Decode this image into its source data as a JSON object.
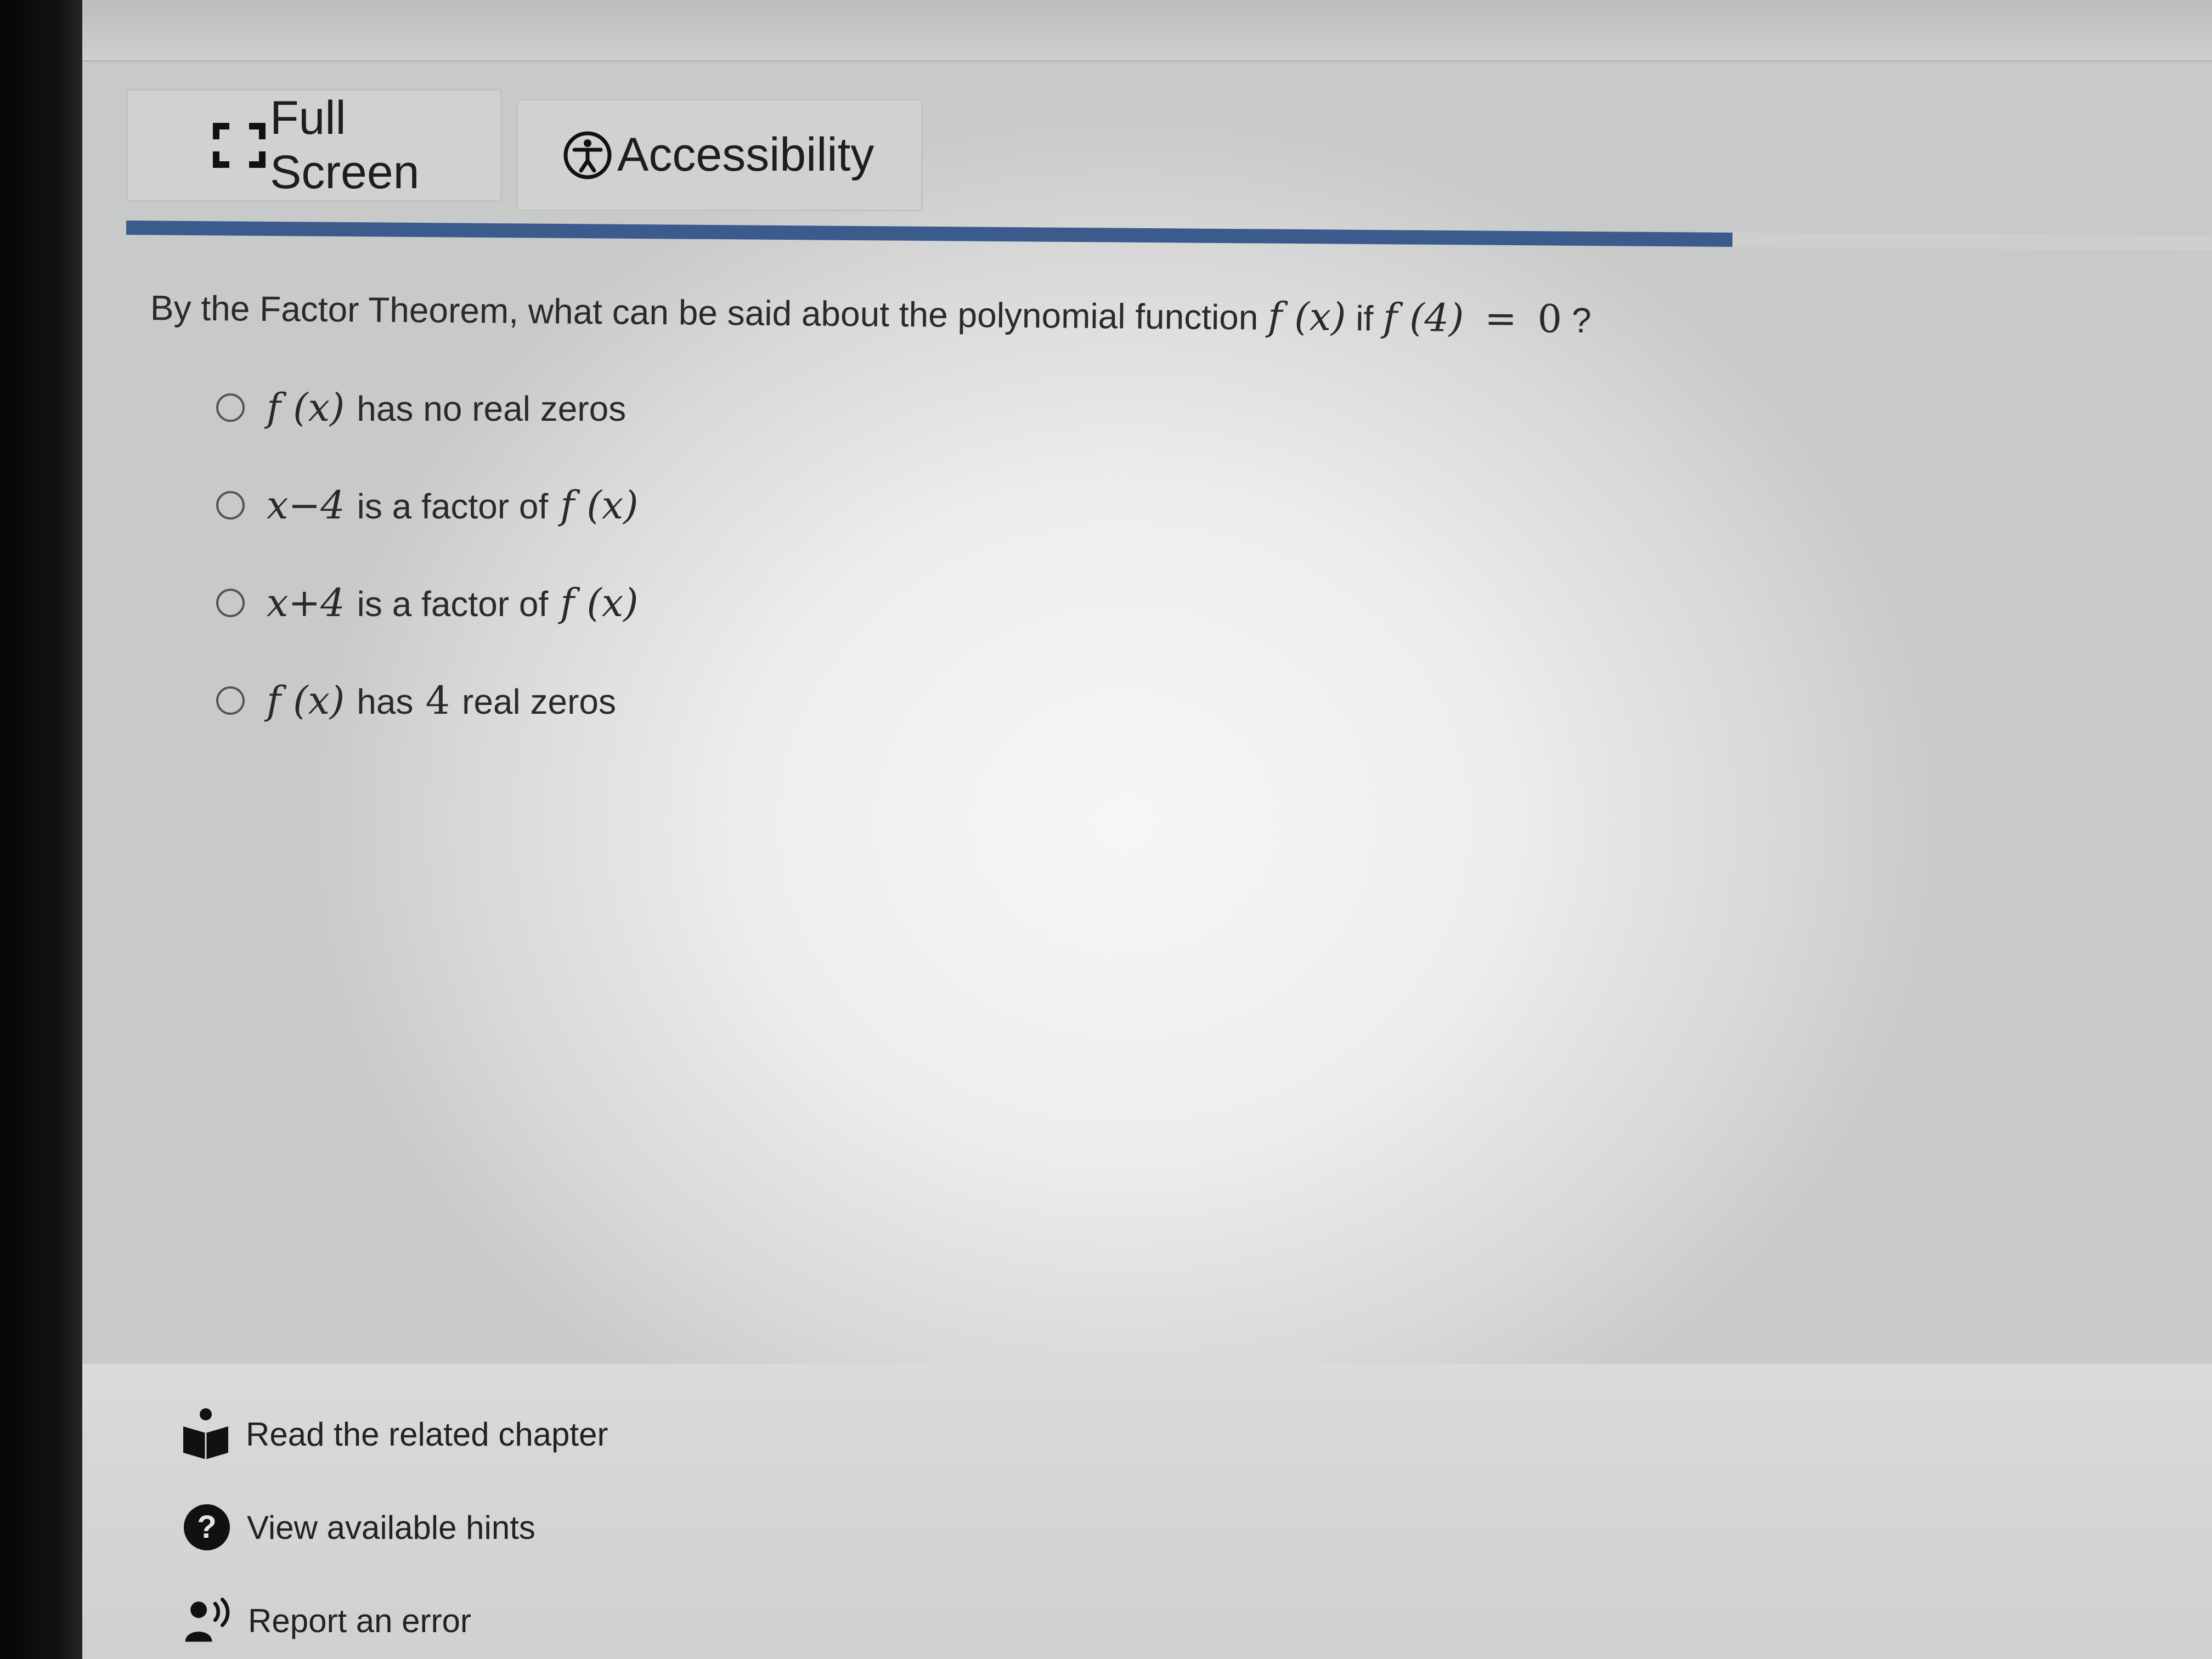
{
  "toolbar": {
    "fullscreen_label": "Full Screen",
    "accessibility_label": "Accessibility"
  },
  "progress": {
    "fraction": 0.77,
    "color": "#3a5b8c"
  },
  "question": {
    "text_before": "By the Factor Theorem, what can be said about the polynomial function",
    "func": "f (x)",
    "text_if": "if",
    "condition_lhs": "f (4)",
    "condition_eq": "=",
    "condition_rhs": "0",
    "question_mark": "?"
  },
  "options": [
    {
      "math": "f (x)",
      "text": "has no real zeros"
    },
    {
      "math": "x−4",
      "text": "is a factor of",
      "math_after": "f (x)"
    },
    {
      "math": "x+4",
      "text": "is a factor of",
      "math_after": "f (x)"
    },
    {
      "math": "f (x)",
      "text": "has",
      "math_mid": "4",
      "text_after": "real zeros"
    }
  ],
  "footer": {
    "chapter_label": "Read the related chapter",
    "hints_label": "View available hints",
    "report_label": "Report an error"
  },
  "icons": {
    "fullscreen": "fullscreen-icon",
    "accessibility": "accessibility-icon",
    "chapter": "book-reader-icon",
    "hints": "question-circle-icon",
    "report": "report-speaker-icon"
  }
}
